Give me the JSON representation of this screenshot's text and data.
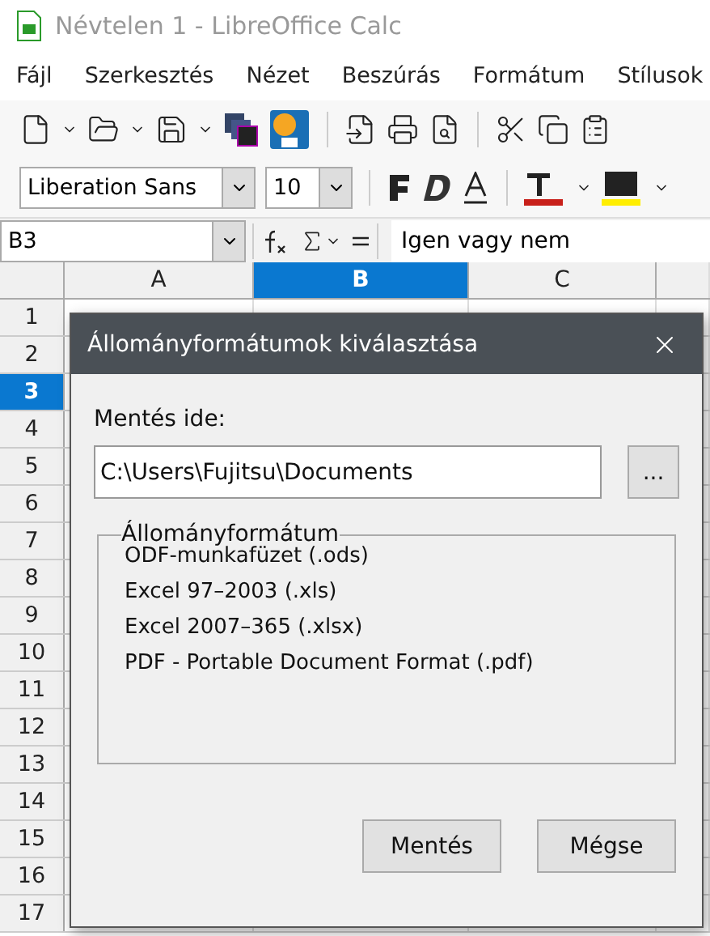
{
  "window": {
    "title": "Névtelen 1 - LibreOffice Calc"
  },
  "menu": [
    "Fájl",
    "Szerkesztés",
    "Nézet",
    "Beszúrás",
    "Formátum",
    "Stílusok"
  ],
  "font": {
    "name": "Liberation Sans",
    "size": "10"
  },
  "formula_bar": {
    "cell": "B3",
    "content": "Igen vagy nem"
  },
  "columns": [
    {
      "label": "A",
      "selected": false
    },
    {
      "label": "B",
      "selected": true
    },
    {
      "label": "C",
      "selected": false
    }
  ],
  "rows": [
    {
      "label": "1",
      "selected": false
    },
    {
      "label": "2",
      "selected": false
    },
    {
      "label": "3",
      "selected": true
    },
    {
      "label": "4",
      "selected": false
    },
    {
      "label": "5",
      "selected": false
    },
    {
      "label": "6",
      "selected": false
    },
    {
      "label": "7",
      "selected": false
    },
    {
      "label": "8",
      "selected": false
    },
    {
      "label": "9",
      "selected": false
    },
    {
      "label": "10",
      "selected": false
    },
    {
      "label": "11",
      "selected": false
    },
    {
      "label": "12",
      "selected": false
    },
    {
      "label": "13",
      "selected": false
    },
    {
      "label": "14",
      "selected": false
    },
    {
      "label": "15",
      "selected": false
    },
    {
      "label": "16",
      "selected": false
    },
    {
      "label": "17",
      "selected": false
    }
  ],
  "dialog": {
    "title": "Állományformátumok kiválasztása",
    "save_to_label": "Mentés ide:",
    "path": "C:\\Users\\Fujitsu\\Documents",
    "browse": "...",
    "group_title": "Állományformátum",
    "formats": [
      "ODF-munkafüzet (.ods)",
      "Excel 97–2003 (.xls)",
      "Excel 2007–365 (.xlsx)",
      "PDF - Portable Document Format (.pdf)"
    ],
    "buttons": [
      "Mentés",
      "Mégse"
    ]
  }
}
